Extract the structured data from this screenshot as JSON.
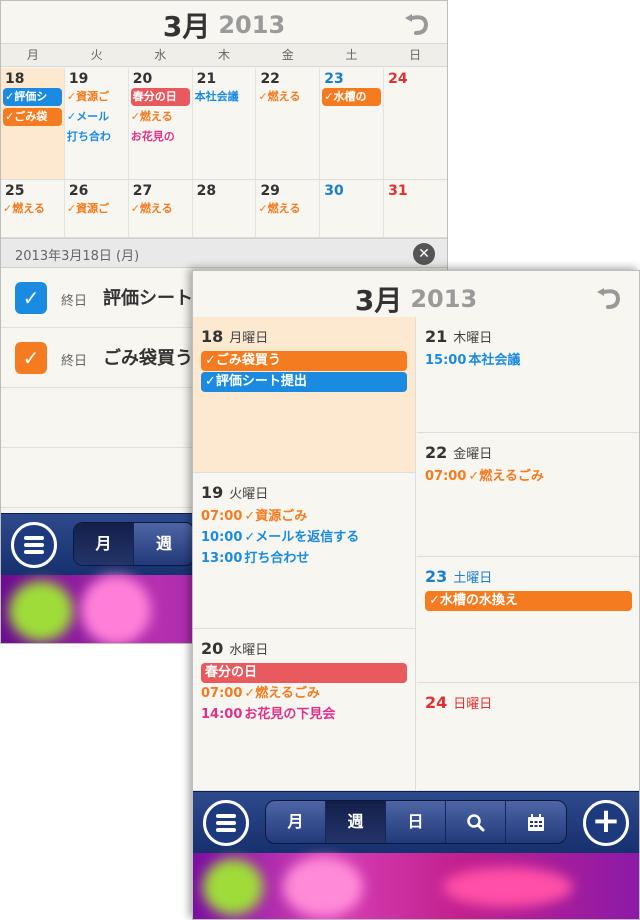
{
  "month_screen": {
    "title_month": "3月",
    "title_year": "2013",
    "weekdays": [
      "月",
      "火",
      "水",
      "木",
      "金",
      "土",
      "日"
    ],
    "week1": [
      {
        "num": "18",
        "events": [
          {
            "text": "✓評価シ",
            "style": "fill blue-fill"
          },
          {
            "text": "✓ごみ袋",
            "style": "fill orange-fill"
          }
        ]
      },
      {
        "num": "19",
        "events": [
          {
            "text": "✓資源ご",
            "style": "orange"
          },
          {
            "text": "✓メール",
            "style": "blue"
          },
          {
            "text": "打ち合わ",
            "style": "blue"
          }
        ]
      },
      {
        "num": "20",
        "events": [
          {
            "text": "春分の日",
            "style": "fill red-fill"
          },
          {
            "text": "✓燃える",
            "style": "orange"
          },
          {
            "text": "お花見の",
            "style": "pink"
          }
        ]
      },
      {
        "num": "21",
        "events": [
          {
            "text": "本社会議",
            "style": "blue"
          }
        ]
      },
      {
        "num": "22",
        "events": [
          {
            "text": "✓燃える",
            "style": "orange"
          }
        ]
      },
      {
        "num": "23",
        "events": [
          {
            "text": "✓水槽の",
            "style": "fill orange-fill"
          }
        ]
      },
      {
        "num": "24",
        "events": []
      }
    ],
    "week2": [
      {
        "num": "25",
        "events": [
          {
            "text": "✓燃える",
            "style": "orange"
          }
        ]
      },
      {
        "num": "26",
        "events": [
          {
            "text": "✓資源ご",
            "style": "orange"
          }
        ]
      },
      {
        "num": "27",
        "events": [
          {
            "text": "✓燃える",
            "style": "orange"
          }
        ]
      },
      {
        "num": "28",
        "events": []
      },
      {
        "num": "29",
        "events": [
          {
            "text": "✓燃える",
            "style": "orange"
          }
        ]
      },
      {
        "num": "30",
        "events": []
      },
      {
        "num": "31",
        "events": []
      }
    ],
    "selected_date_label": "2013年3月18日 (月)",
    "close_glyph": "✕",
    "todos": [
      {
        "when": "終日",
        "title": "評価シート提出",
        "color": "#1a8be0"
      },
      {
        "when": "終日",
        "title": "ごみ袋買う",
        "color": "#f47b20"
      }
    ],
    "toolbar": {
      "segments": [
        "月",
        "週"
      ]
    }
  },
  "week_screen": {
    "title_month": "3月",
    "title_year": "2013",
    "left": [
      {
        "day": "18",
        "dow": "月曜日",
        "kind": "",
        "events": [
          {
            "time": "",
            "text": "✓ごみ袋買う",
            "style": "bar orange-fill"
          },
          {
            "time": "",
            "text": "✓評価シート提出",
            "style": "bar blue-fill"
          }
        ]
      },
      {
        "day": "19",
        "dow": "火曜日",
        "kind": "",
        "events": [
          {
            "time": "07:00",
            "text": "✓資源ごみ",
            "style": "orange"
          },
          {
            "time": "10:00",
            "text": "✓メールを返信する",
            "style": "blue"
          },
          {
            "time": "13:00",
            "text": "打ち合わせ",
            "style": "blue"
          }
        ]
      },
      {
        "day": "20",
        "dow": "水曜日",
        "kind": "",
        "events": [
          {
            "time": "",
            "text": "春分の日",
            "style": "bar red-fill"
          },
          {
            "time": "07:00",
            "text": "✓燃えるごみ",
            "style": "orange"
          },
          {
            "time": "14:00",
            "text": "お花見の下見会",
            "style": "pink"
          }
        ]
      }
    ],
    "right": [
      {
        "day": "21",
        "dow": "木曜日",
        "kind": "",
        "events": [
          {
            "time": "15:00",
            "text": "本社会議",
            "style": "blue"
          }
        ]
      },
      {
        "day": "22",
        "dow": "金曜日",
        "kind": "",
        "events": [
          {
            "time": "07:00",
            "text": "✓燃えるごみ",
            "style": "orange"
          }
        ]
      },
      {
        "day": "23",
        "dow": "土曜日",
        "kind": "sat",
        "events": [
          {
            "time": "",
            "text": "✓水槽の水換え",
            "style": "bar orange-fill"
          }
        ]
      },
      {
        "day": "24",
        "dow": "日曜日",
        "kind": "sun",
        "events": []
      }
    ],
    "toolbar": {
      "segments": [
        "月",
        "週",
        "日"
      ],
      "active_segment": "週"
    }
  }
}
